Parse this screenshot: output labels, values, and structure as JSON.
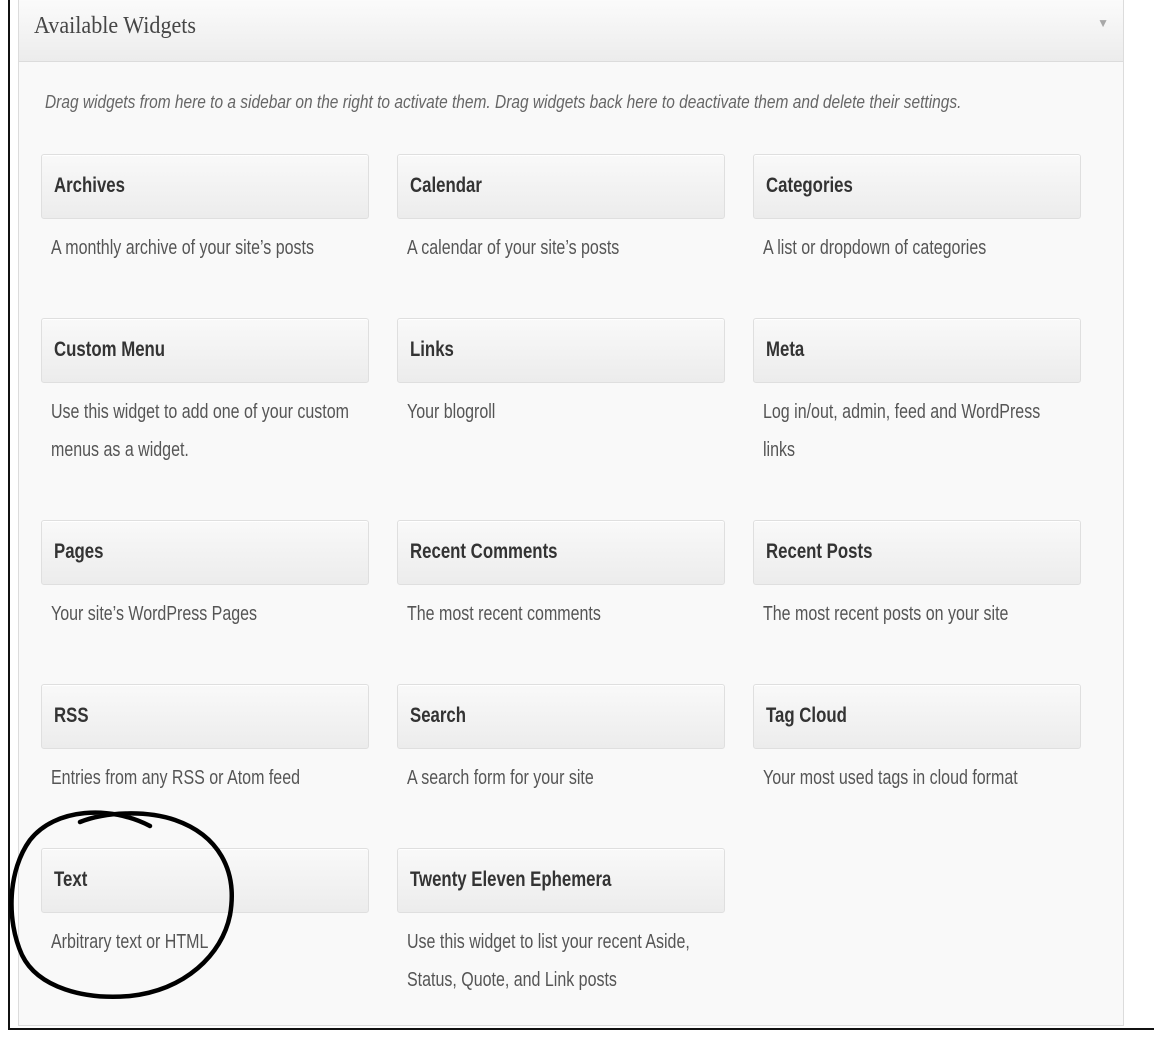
{
  "panel": {
    "title": "Available Widgets",
    "toggle_icon": "triangle-down-icon",
    "description": "Drag widgets from here to a sidebar on the right to activate them. Drag widgets back here to deactivate them and delete their settings."
  },
  "widgets": [
    {
      "title": "Archives",
      "description": "A monthly archive of your site’s posts"
    },
    {
      "title": "Calendar",
      "description": "A calendar of your site’s posts"
    },
    {
      "title": "Categories",
      "description": "A list or dropdown of categories"
    },
    {
      "title": "Custom Menu",
      "description": "Use this widget to add one of your custom menus as a widget."
    },
    {
      "title": "Links",
      "description": "Your blogroll"
    },
    {
      "title": "Meta",
      "description": "Log in/out, admin, feed and WordPress links"
    },
    {
      "title": "Pages",
      "description": "Your site’s WordPress Pages"
    },
    {
      "title": "Recent Comments",
      "description": "The most recent comments"
    },
    {
      "title": "Recent Posts",
      "description": "The most recent posts on your site"
    },
    {
      "title": "RSS",
      "description": "Entries from any RSS or Atom feed"
    },
    {
      "title": "Search",
      "description": "A search form for your site"
    },
    {
      "title": "Tag Cloud",
      "description": "Your most used tags in cloud format"
    },
    {
      "title": "Text",
      "description": "Arbitrary text or HTML"
    },
    {
      "title": "Twenty Eleven Ephemera",
      "description": "Use this widget to list your recent Aside, Status, Quote, and Link posts"
    }
  ],
  "colors": {
    "panel_bg": "#f9f9f9",
    "annotation_ink": "#000000"
  }
}
